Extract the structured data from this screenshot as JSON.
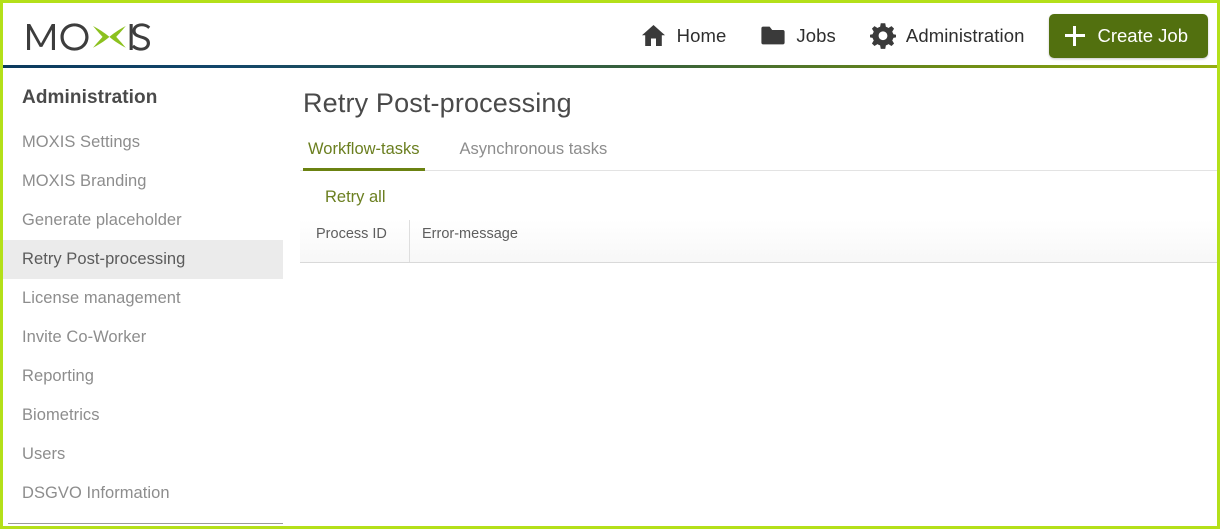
{
  "header": {
    "logo_text": "MOXIS",
    "nav": [
      {
        "label": "Home",
        "icon": "home-icon"
      },
      {
        "label": "Jobs",
        "icon": "folder-icon"
      },
      {
        "label": "Administration",
        "icon": "gear-icon"
      }
    ],
    "create_job_label": "Create Job",
    "create_job_icon": "plus-icon",
    "accent_color": "#b4e019",
    "button_color": "#52700f"
  },
  "sidebar": {
    "title": "Administration",
    "items": [
      {
        "label": "MOXIS Settings",
        "active": false
      },
      {
        "label": "MOXIS Branding",
        "active": false
      },
      {
        "label": "Generate placeholder",
        "active": false
      },
      {
        "label": "Retry Post-processing",
        "active": true
      },
      {
        "label": "License management",
        "active": false
      },
      {
        "label": "Invite Co-Worker",
        "active": false
      },
      {
        "label": "Reporting",
        "active": false
      },
      {
        "label": "Biometrics",
        "active": false
      },
      {
        "label": "Users",
        "active": false
      },
      {
        "label": "DSGVO Information",
        "active": false
      }
    ]
  },
  "main": {
    "page_title": "Retry Post-processing",
    "tabs": [
      {
        "label": "Workflow-tasks",
        "active": true
      },
      {
        "label": "Asynchronous tasks",
        "active": false
      }
    ],
    "retry_all_label": "Retry all",
    "table": {
      "columns": [
        "Process ID",
        "Error-message"
      ],
      "rows": []
    }
  }
}
